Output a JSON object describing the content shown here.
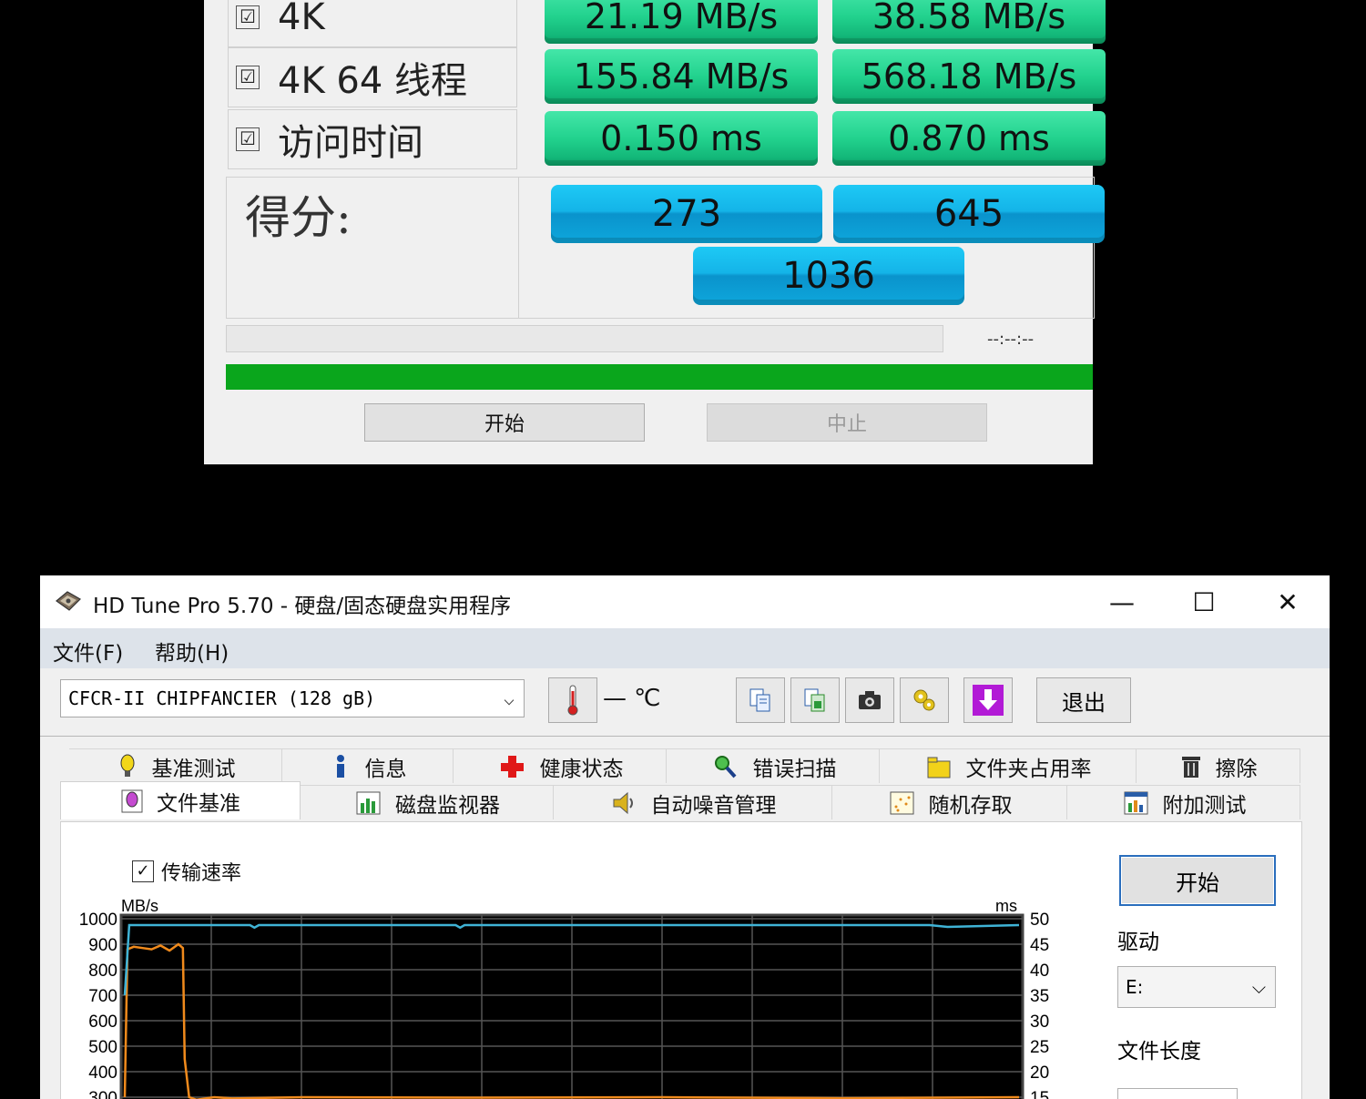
{
  "asssd": {
    "rows": [
      {
        "label": "4K",
        "read": "21.19 MB/s",
        "write": "38.58 MB/s"
      },
      {
        "label": "4K 64 线程",
        "read": "155.84 MB/s",
        "write": "568.18 MB/s"
      },
      {
        "label": "访问时间",
        "read": "0.150 ms",
        "write": "0.870 ms"
      }
    ],
    "score_label": "得分:",
    "score_read": "273",
    "score_write": "645",
    "score_total": "1036",
    "progress_time": "--:--:--",
    "progress_fraction": 1.0,
    "start_label": "开始",
    "stop_label": "中止",
    "check_glyph": "☑",
    "colors": {
      "green": "#22d28e",
      "blue": "#14b4e8",
      "progress": "#0aa61c"
    }
  },
  "hdtune": {
    "title": "HD Tune Pro 5.70 - 硬盘/固态硬盘实用程序",
    "window_controls": {
      "minimize": "—",
      "maximize": "☐",
      "close": "✕"
    },
    "menu": [
      {
        "label": "文件(F)"
      },
      {
        "label": "帮助(H)"
      }
    ],
    "drive_select": "CFCR-II CHIPFANCIER (128 gB)",
    "temperature": "— ℃",
    "exit_label": "退出",
    "tabs_row1": [
      {
        "label": "基准测试",
        "icon": "lightbulb-icon"
      },
      {
        "label": "信息",
        "icon": "info-icon"
      },
      {
        "label": "健康状态",
        "icon": "health-cross-icon"
      },
      {
        "label": "错误扫描",
        "icon": "magnifier-icon"
      },
      {
        "label": "文件夹占用率",
        "icon": "folder-icon"
      },
      {
        "label": "擦除",
        "icon": "trash-icon"
      }
    ],
    "tabs_row2": [
      {
        "label": "文件基准",
        "icon": "file-benchmark-icon",
        "active": true
      },
      {
        "label": "磁盘监视器",
        "icon": "bar-chart-icon"
      },
      {
        "label": "自动噪音管理",
        "icon": "speaker-icon"
      },
      {
        "label": "随机存取",
        "icon": "scatter-icon"
      },
      {
        "label": "附加测试",
        "icon": "extra-tests-icon"
      }
    ],
    "transfer_rate_label": "传输速率",
    "start_label": "开始",
    "drive_label": "驱动",
    "drive_value": "E:",
    "file_length_label": "文件长度"
  },
  "chart_data": {
    "type": "line",
    "ylabel": "MB/s",
    "y2label": "ms",
    "ylim": [
      0,
      1000
    ],
    "y2lim": [
      0,
      50
    ],
    "yticks": [
      "1000",
      "900",
      "800",
      "700",
      "600",
      "500",
      "400",
      "300"
    ],
    "y2ticks": [
      "50",
      "45",
      "40",
      "35",
      "30",
      "25",
      "20",
      "15"
    ],
    "grid": true,
    "series": [
      {
        "color": "#f08a1c",
        "x": [
          0,
          0.3,
          1,
          2,
          3,
          4,
          5,
          6,
          6.5,
          6.7,
          7.2,
          8,
          10,
          12,
          20,
          40,
          60,
          80,
          100
        ],
        "y": [
          300,
          880,
          890,
          885,
          880,
          895,
          875,
          900,
          885,
          450,
          300,
          290,
          300,
          295,
          300,
          298,
          300,
          296,
          300
        ]
      },
      {
        "color": "#3fb3d6",
        "x": [
          0,
          0.5,
          10,
          14,
          14.5,
          15,
          37,
          37.5,
          38,
          60,
          80,
          90,
          92,
          100
        ],
        "y": [
          700,
          975,
          975,
          975,
          965,
          975,
          975,
          965,
          975,
          975,
          975,
          975,
          968,
          975
        ]
      }
    ]
  }
}
